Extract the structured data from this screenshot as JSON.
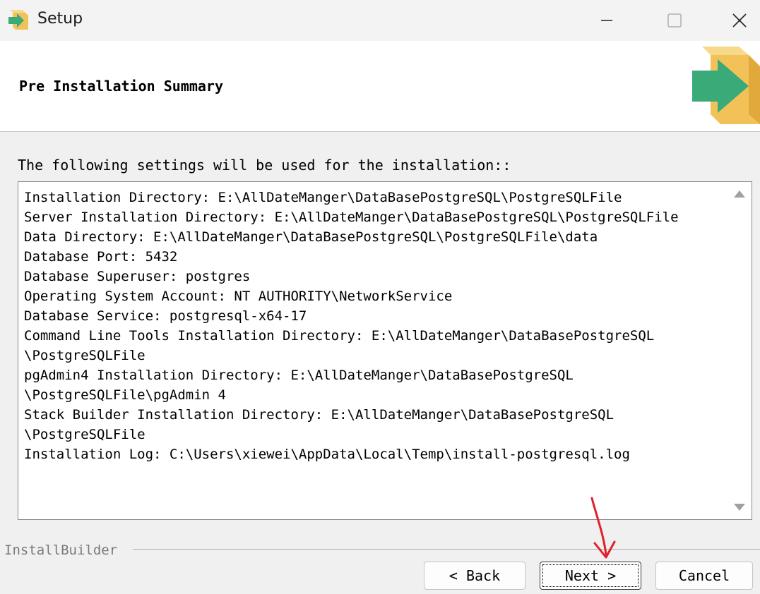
{
  "window": {
    "title": "Setup",
    "icon": "installer-box-icon",
    "controls": [
      "minimize-icon",
      "maximize-icon",
      "close-icon"
    ]
  },
  "header": {
    "heading": "Pre Installation Summary",
    "logo": "installer-box-logo"
  },
  "body": {
    "intro": "The following settings will be used for the installation::",
    "summary_lines": [
      "Installation Directory: E:\\AllDateManger\\DataBasePostgreSQL\\PostgreSQLFile",
      "Server Installation Directory: E:\\AllDateManger\\DataBasePostgreSQL\\PostgreSQLFile",
      "Data Directory: E:\\AllDateManger\\DataBasePostgreSQL\\PostgreSQLFile\\data",
      "Database Port: 5432",
      "Database Superuser: postgres",
      "Operating System Account: NT AUTHORITY\\NetworkService",
      "Database Service: postgresql-x64-17",
      "Command Line Tools Installation Directory: E:\\AllDateManger\\DataBasePostgreSQL",
      "\\PostgreSQLFile",
      "pgAdmin4 Installation Directory: E:\\AllDateManger\\DataBasePostgreSQL",
      "\\PostgreSQLFile\\pgAdmin 4",
      "Stack Builder Installation Directory: E:\\AllDateManger\\DataBasePostgreSQL",
      "\\PostgreSQLFile",
      "Installation Log: C:\\Users\\xiewei\\AppData\\Local\\Temp\\install-postgresql.log"
    ]
  },
  "footer": {
    "brand": "InstallBuilder",
    "back_label": "< Back",
    "next_label": "Next >",
    "cancel_label": "Cancel"
  },
  "colors": {
    "annotation_arrow": "#e0202a",
    "logo_green": "#3aaa78",
    "logo_box": "#f2c259"
  }
}
